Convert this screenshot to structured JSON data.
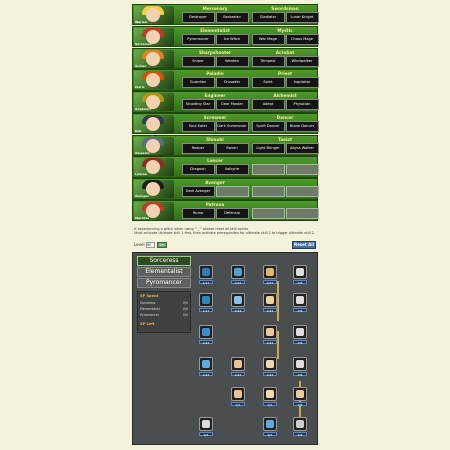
{
  "classes": [
    {
      "portrait": "Warrior",
      "hair": "#f4d03f",
      "a": {
        "title": "Mercenary",
        "subs": [
          "Destroyer",
          "Barbarian"
        ]
      },
      "b": {
        "title": "Swordsman",
        "subs": [
          "Gladiator",
          "Lunar Knight"
        ]
      }
    },
    {
      "portrait": "Sorceress",
      "hair": "#c0392b",
      "a": {
        "title": "Elementalist",
        "subs": [
          "Pyromancer",
          "Ice Witch"
        ]
      },
      "b": {
        "title": "Mystic",
        "subs": [
          "War Mage",
          "Chaos Mage"
        ]
      }
    },
    {
      "portrait": "Archer",
      "hair": "#e67e22",
      "a": {
        "title": "Sharpshooter",
        "subs": [
          "Sniper",
          "Warden"
        ]
      },
      "b": {
        "title": "Acrobat",
        "subs": [
          "Tempest",
          "Windwalker"
        ]
      }
    },
    {
      "portrait": "Cleric",
      "hair": "#d35400",
      "a": {
        "title": "Paladin",
        "subs": [
          "Guardian",
          "Crusader"
        ]
      },
      "b": {
        "title": "Priest",
        "subs": [
          "Saint",
          "Inquisitor"
        ]
      }
    },
    {
      "portrait": "Academic",
      "hair": "#b7950b",
      "a": {
        "title": "Engineer",
        "subs": [
          "Shooting Star",
          "Gear Master"
        ]
      },
      "b": {
        "title": "Alchemist",
        "subs": [
          "Adept",
          "Physician"
        ]
      }
    },
    {
      "portrait": "Kali",
      "hair": "#2c3e50",
      "a": {
        "title": "Screamer",
        "subs": [
          "Soul Eater",
          "Dark Summoner"
        ]
      },
      "b": {
        "title": "Dancer",
        "subs": [
          "Spirit Dancer",
          "Blade Dancer"
        ]
      }
    },
    {
      "portrait": "Assassin",
      "hair": "#5d6d7e",
      "a": {
        "title": "Shinobi",
        "subs": [
          "Reaper",
          "Raven"
        ]
      },
      "b": {
        "title": "Taoist",
        "subs": [
          "Light Bringer",
          "Abyss Walker"
        ]
      }
    },
    {
      "portrait": "Lancea",
      "hair": "#922b21",
      "a": {
        "title": "Lancer",
        "subs": [
          "Dragoon",
          "Valkyrie"
        ]
      },
      "b": {
        "title": "",
        "subs": [
          "",
          ""
        ]
      }
    },
    {
      "portrait": "Avenger",
      "hair": "#1c1c1c",
      "a": {
        "title": "Avenger",
        "subs": [
          "Dark Avenger",
          ""
        ]
      },
      "b": {
        "title": "",
        "subs": [
          "",
          ""
        ]
      }
    },
    {
      "portrait": "Machina",
      "hair": "#c0392b",
      "a": {
        "title": "Patrona",
        "subs": [
          "Ruina",
          "Defensio"
        ]
      },
      "b": {
        "title": "",
        "subs": [
          "",
          ""
        ]
      }
    }
  ],
  "notes": {
    "line1": "- If experiencing a glitch when using ^_^ please reset all skill points.",
    "line2": "- Must activate ultimate skill 1 first, then activate prerequisites for ultimate skill 2 to trigger ultimate skill 2."
  },
  "level": {
    "label": "Level",
    "value": "90",
    "button": "Set"
  },
  "reset_label": "Reset All",
  "tabs": [
    "Sorceress",
    "Elementalist",
    "Pyromancer"
  ],
  "sp": {
    "spent_label": "SP Spent",
    "left_label": "SP Left",
    "rows": [
      {
        "name": "Sorceress",
        "value": "0/0"
      },
      {
        "name": "Elementalist",
        "value": "0/0"
      },
      {
        "name": "Pyromancer",
        "value": "0/0"
      }
    ]
  },
  "skills": [
    {
      "lv": "1/17",
      "color": "#2f7bbf"
    },
    {
      "lv": "0/16",
      "color": "#4da3d6"
    },
    {
      "lv": "0/15",
      "color": "#e0b86a"
    },
    {
      "lv": "0/5",
      "color": "#ddd"
    },
    {
      "lv": "1/17",
      "color": "#2e86c1"
    },
    {
      "lv": "0/16",
      "color": "#85c1e9"
    },
    {
      "lv": "0/15",
      "color": "#f0d39a"
    },
    {
      "lv": "0/5",
      "color": "#ddd"
    },
    {
      "lv": "0/15",
      "color": "#3b8ed3"
    },
    {
      "lv": "0/15",
      "color": "#ecc7a0"
    },
    {
      "lv": "0/5",
      "color": "#ddd"
    },
    {
      "lv": "0/15",
      "color": "#5dade2"
    },
    {
      "lv": "0/15",
      "color": "#e8c496"
    },
    {
      "lv": "0/15",
      "color": "#f3d7ae"
    },
    {
      "lv": "0/5",
      "color": "#ddd"
    },
    {
      "lv": "0/1",
      "color": "#e8c496"
    },
    {
      "lv": "0/1",
      "color": "#f3d7ae"
    },
    {
      "lv": "0/4",
      "color": "#ecc7a0"
    },
    {
      "lv": "0/4",
      "color": "#ddd"
    },
    {
      "lv": "0/1",
      "color": "#5dade2"
    },
    {
      "lv": "0/4",
      "color": "#ccc"
    }
  ]
}
